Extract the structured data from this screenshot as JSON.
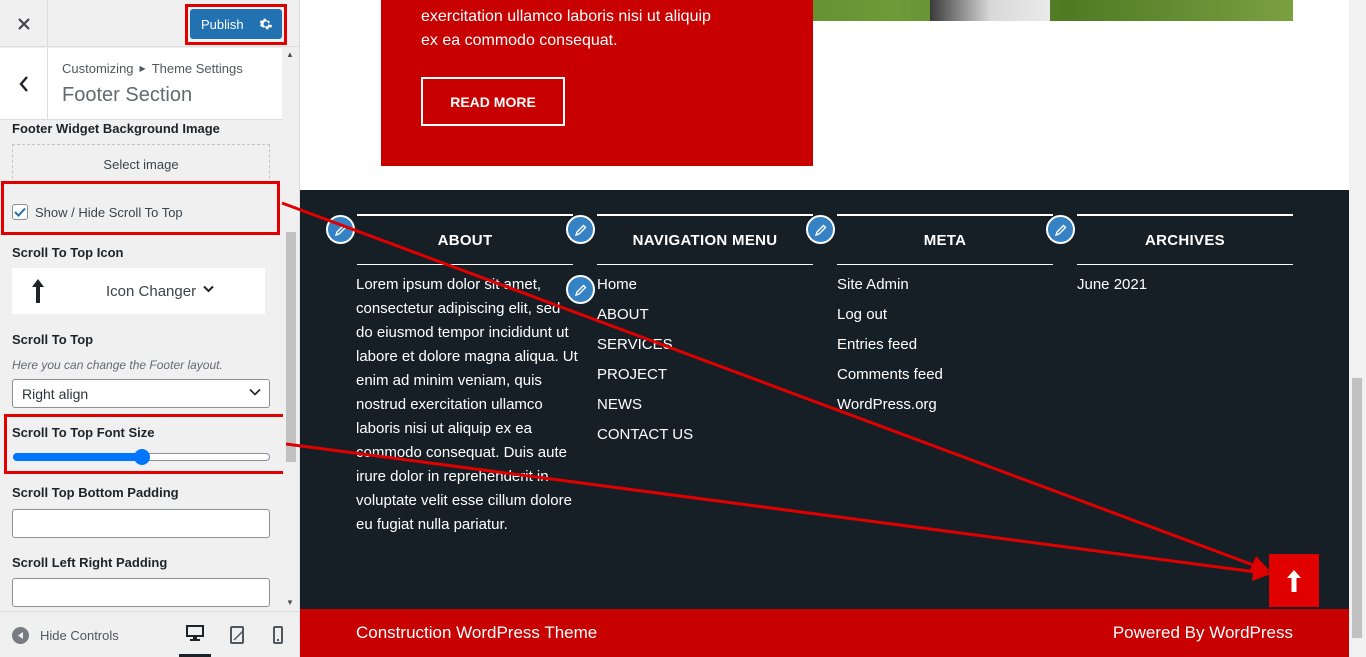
{
  "sidebar": {
    "publish_label": "Publish",
    "breadcrumb_root": "Customizing",
    "breadcrumb_parent": "Theme Settings",
    "section_title": "Footer Section",
    "footer_bg_label": "Footer Widget Background Image",
    "select_image_label": "Select image",
    "scroll_toggle_label": "Show / Hide Scroll To Top",
    "scroll_toggle_checked": true,
    "scroll_icon_label": "Scroll To Top Icon",
    "icon_changer_label": "Icon Changer",
    "scroll_to_top_label": "Scroll To Top",
    "scroll_to_top_desc": "Here you can change the Footer layout.",
    "align_selected": "Right align",
    "font_size_label": "Scroll To Top Font Size",
    "font_size_fraction": 0.5,
    "bottom_padding_label": "Scroll Top Bottom Padding",
    "lr_padding_label": "Scroll Left Right Padding",
    "hide_controls_label": "Hide Controls"
  },
  "preview": {
    "card_text": "exercitation ullamco laboris nisi ut aliquip ex ea commodo consequat.",
    "read_more_label": "READ MORE",
    "widgets": {
      "about_title": "ABOUT",
      "about_text": "Lorem ipsum dolor sit amet, consectetur adipiscing elit, sed do eiusmod tempor incididunt ut labore et dolore magna aliqua. Ut enim ad minim veniam, quis nostrud exercitation ullamco laboris nisi ut aliquip ex ea commodo consequat. Duis aute irure dolor in reprehenderit in voluptate velit esse cillum dolore eu fugiat nulla pariatur.",
      "nav_title": "NAVIGATION MENU",
      "nav_items": [
        "Home",
        "ABOUT",
        "SERVICES",
        "PROJECT",
        "NEWS",
        "CONTACT US"
      ],
      "meta_title": "META",
      "meta_items": [
        "Site Admin",
        "Log out",
        "Entries feed",
        "Comments feed",
        "WordPress.org"
      ],
      "archives_title": "ARCHIVES",
      "archive_items": [
        "June 2021"
      ]
    },
    "footer_left": "Construction WordPress Theme",
    "footer_right": "Powered By WordPress"
  },
  "colors": {
    "brand_red": "#c80000",
    "footer_dark": "#161f26",
    "wp_blue": "#2271b1",
    "highlight": "#e00000"
  },
  "icons": [
    "close-icon",
    "gear-icon",
    "chevron-left-icon",
    "arrow-up-icon",
    "chevron-down-icon",
    "eye-icon",
    "desktop-icon",
    "tablet-icon",
    "mobile-icon",
    "pencil-icon"
  ]
}
